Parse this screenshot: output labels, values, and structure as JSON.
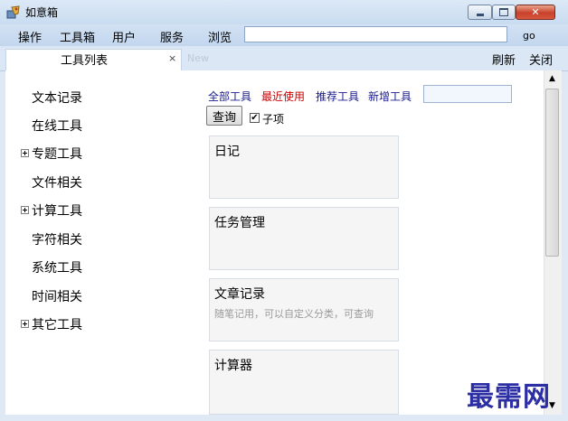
{
  "window": {
    "title": "如意箱",
    "accent": "#c9dcf0",
    "close_color": "#c9412a"
  },
  "menu": {
    "items": [
      "操作",
      "工具箱",
      "用户",
      "服务",
      "浏览"
    ],
    "url_value": "",
    "go_label": "go"
  },
  "tabs": {
    "active_label": "工具列表",
    "close_glyph": "×",
    "new_tab_label": "New",
    "refresh_label": "刷新",
    "close_label": "关闭"
  },
  "tree": {
    "items": [
      {
        "label": "文本记录",
        "expandable": false
      },
      {
        "label": "在线工具",
        "expandable": false
      },
      {
        "label": "专题工具",
        "expandable": true
      },
      {
        "label": "文件相关",
        "expandable": false
      },
      {
        "label": "计算工具",
        "expandable": true
      },
      {
        "label": "字符相关",
        "expandable": false
      },
      {
        "label": "系统工具",
        "expandable": false
      },
      {
        "label": "时间相关",
        "expandable": false
      },
      {
        "label": "其它工具",
        "expandable": true
      }
    ]
  },
  "filters": {
    "links": [
      {
        "label": "全部工具",
        "color": "#1a1a8c"
      },
      {
        "label": "最近使用",
        "color": "#cc0000"
      },
      {
        "label": "推荐工具",
        "color": "#1a1a8c"
      },
      {
        "label": "新增工具",
        "color": "#1a1a8c"
      }
    ],
    "search_value": "",
    "query_label": "查询",
    "subitem_label": "子项",
    "subitem_checked": true,
    "check_glyph": "✔"
  },
  "cards": [
    {
      "title": "日记",
      "desc": ""
    },
    {
      "title": "任务管理",
      "desc": ""
    },
    {
      "title": "文章记录",
      "desc": "随笔记用，可以自定义分类，可查询"
    },
    {
      "title": "计算器",
      "desc": ""
    }
  ],
  "scroll": {
    "up_glyph": "▲",
    "down_glyph": "▼"
  },
  "watermark": "最需网"
}
